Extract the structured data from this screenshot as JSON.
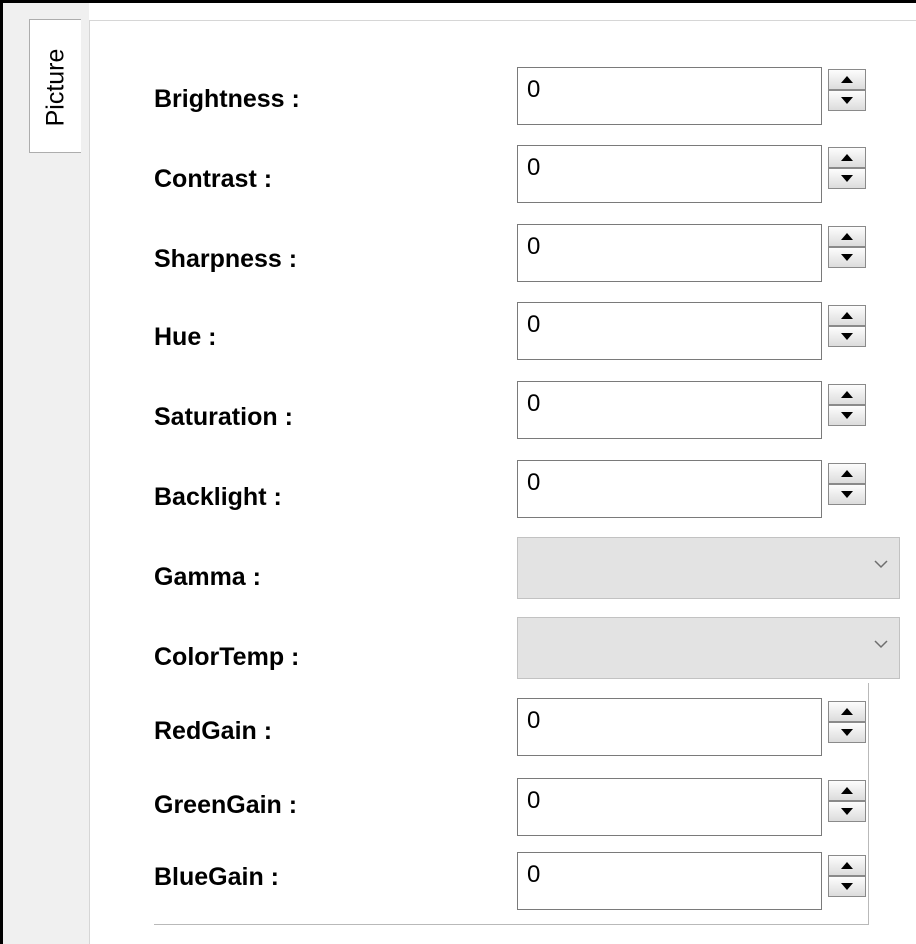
{
  "tab": {
    "label": "Picture"
  },
  "fields": {
    "brightness": {
      "label": "Brightness :",
      "value": "0"
    },
    "contrast": {
      "label": "Contrast :",
      "value": "0"
    },
    "sharpness": {
      "label": "Sharpness :",
      "value": "0"
    },
    "hue": {
      "label": "Hue :",
      "value": "0"
    },
    "saturation": {
      "label": "Saturation :",
      "value": "0"
    },
    "backlight": {
      "label": "Backlight :",
      "value": "0"
    },
    "gamma": {
      "label": "Gamma :",
      "value": ""
    },
    "colortemp": {
      "label": "ColorTemp :",
      "value": ""
    },
    "redgain": {
      "label": "RedGain :",
      "value": "0"
    },
    "greengain": {
      "label": "GreenGain :",
      "value": "0"
    },
    "bluegain": {
      "label": "BlueGain :",
      "value": "0"
    }
  },
  "icons": {
    "spin_up": "triangle-up-icon",
    "spin_down": "triangle-down-icon",
    "dropdown": "chevron-down-icon"
  },
  "colors": {
    "disabled_combo": "#e3e3e3",
    "tab_strip": "#f0f0f0"
  }
}
